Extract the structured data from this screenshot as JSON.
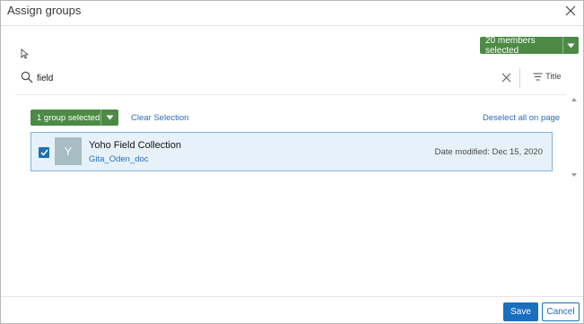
{
  "dialog": {
    "title": "Assign groups"
  },
  "members_selected": {
    "label": "20 members selected"
  },
  "search": {
    "value": "field",
    "sort_label": "Title"
  },
  "selection": {
    "group_selected_label": "1 group selected",
    "clear_selection_label": "Clear Selection",
    "deselect_all_label": "Deselect all on page"
  },
  "results": [
    {
      "thumbnail_letter": "Y",
      "title": "Yoho Field Collection",
      "owner": "Gita_Oden_doc",
      "date_modified": "Date modified: Dec 15, 2020",
      "checked": true
    }
  ],
  "footer": {
    "save_label": "Save",
    "cancel_label": "Cancel"
  },
  "colors": {
    "accent_green": "#4c8a45",
    "primary_blue": "#1b6fbf",
    "link_blue": "#2a6eb5",
    "selected_card_bg": "#e6f1f9"
  },
  "icons": [
    "close-icon",
    "cursor-icon",
    "chevron-down-icon",
    "search-icon",
    "clear-icon",
    "sort-icon",
    "check-icon"
  ]
}
